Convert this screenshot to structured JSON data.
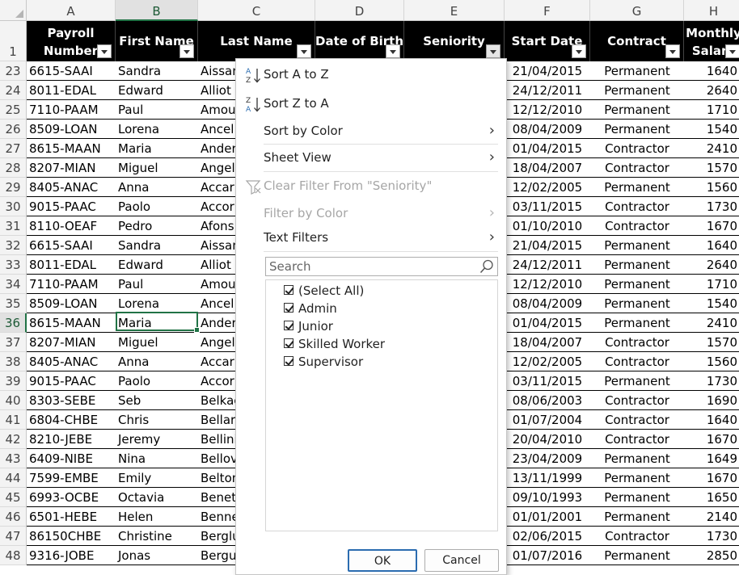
{
  "columns": [
    "A",
    "B",
    "C",
    "D",
    "E",
    "F",
    "G",
    "H"
  ],
  "header_labels": {
    "A": [
      "Payroll",
      "Number"
    ],
    "B": [
      "First Name"
    ],
    "C": [
      "Last Name"
    ],
    "D": [
      "Date of Birth"
    ],
    "E": [
      "Seniority"
    ],
    "F": [
      "Start Date"
    ],
    "G": [
      "Contract"
    ],
    "H": [
      "Monthly",
      "Salary"
    ]
  },
  "header_row_number": "1",
  "rows": [
    {
      "n": "23",
      "a": "6615-SAAI",
      "b": "Sandra",
      "c": "Aissan",
      "f": "21/04/2015",
      "g": "Permanent",
      "h": "1640"
    },
    {
      "n": "24",
      "a": "8011-EDAL",
      "b": "Edward",
      "c": "Alliot",
      "f": "24/12/2011",
      "g": "Permanent",
      "h": "2640"
    },
    {
      "n": "25",
      "a": "7110-PAAM",
      "b": "Paul",
      "c": "Amou",
      "f": "12/12/2010",
      "g": "Permanent",
      "h": "1710"
    },
    {
      "n": "26",
      "a": "8509-LOAN",
      "b": "Lorena",
      "c": "Ancel",
      "f": "08/04/2009",
      "g": "Permanent",
      "h": "1540"
    },
    {
      "n": "27",
      "a": "8615-MAAN",
      "b": "Maria",
      "c": "Ander",
      "f": "01/04/2015",
      "g": "Contractor",
      "h": "2410"
    },
    {
      "n": "28",
      "a": "8207-MIAN",
      "b": "Miguel",
      "c": "Angel",
      "f": "18/04/2007",
      "g": "Contractor",
      "h": "1570"
    },
    {
      "n": "29",
      "a": "8405-ANAC",
      "b": "Anna",
      "c": "Accar",
      "f": "12/02/2005",
      "g": "Permanent",
      "h": "1560"
    },
    {
      "n": "30",
      "a": "9015-PAAC",
      "b": "Paolo",
      "c": "Accor",
      "f": "03/11/2015",
      "g": "Contractor",
      "h": "1730"
    },
    {
      "n": "31",
      "a": "8110-OEAF",
      "b": "Pedro",
      "c": "Afons",
      "f": "01/10/2010",
      "g": "Contractor",
      "h": "1670"
    },
    {
      "n": "32",
      "a": "6615-SAAI",
      "b": "Sandra",
      "c": "Aissan",
      "f": "21/04/2015",
      "g": "Permanent",
      "h": "1640"
    },
    {
      "n": "33",
      "a": "8011-EDAL",
      "b": "Edward",
      "c": "Alliot",
      "f": "24/12/2011",
      "g": "Permanent",
      "h": "2640"
    },
    {
      "n": "34",
      "a": "7110-PAAM",
      "b": "Paul",
      "c": "Amou",
      "f": "12/12/2010",
      "g": "Permanent",
      "h": "1710"
    },
    {
      "n": "35",
      "a": "8509-LOAN",
      "b": "Lorena",
      "c": "Ancel",
      "f": "08/04/2009",
      "g": "Permanent",
      "h": "1540"
    },
    {
      "n": "36",
      "a": "8615-MAAN",
      "b": "Maria",
      "c": "Ander",
      "f": "01/04/2015",
      "g": "Permanent",
      "h": "2410"
    },
    {
      "n": "37",
      "a": "8207-MIAN",
      "b": "Miguel",
      "c": "Angel",
      "f": "18/04/2007",
      "g": "Contractor",
      "h": "1570"
    },
    {
      "n": "38",
      "a": "8405-ANAC",
      "b": "Anna",
      "c": "Accar",
      "f": "12/02/2005",
      "g": "Contractor",
      "h": "1560"
    },
    {
      "n": "39",
      "a": "9015-PAAC",
      "b": "Paolo",
      "c": "Accor",
      "f": "03/11/2015",
      "g": "Permanent",
      "h": "1730"
    },
    {
      "n": "40",
      "a": "8303-SEBE",
      "b": "Seb",
      "c": "Belkac",
      "f": "08/06/2003",
      "g": "Contractor",
      "h": "1690"
    },
    {
      "n": "41",
      "a": "6804-CHBE",
      "b": "Chris",
      "c": "Bellar",
      "f": "01/07/2004",
      "g": "Contractor",
      "h": "1640"
    },
    {
      "n": "42",
      "a": "8210-JEBE",
      "b": "Jeremy",
      "c": "Bellini",
      "f": "20/04/2010",
      "g": "Contractor",
      "h": "1670"
    },
    {
      "n": "43",
      "a": "6409-NIBE",
      "b": "Nina",
      "c": "Bellov",
      "f": "23/04/2009",
      "g": "Permanent",
      "h": "1649"
    },
    {
      "n": "44",
      "a": "7599-EMBE",
      "b": "Emily",
      "c": "Belton",
      "f": "13/11/1999",
      "g": "Permanent",
      "h": "1670"
    },
    {
      "n": "45",
      "a": "6993-OCBE",
      "b": "Octavia",
      "c": "Benet",
      "f": "09/10/1993",
      "g": "Permanent",
      "h": "1650"
    },
    {
      "n": "46",
      "a": "6501-HEBE",
      "b": "Helen",
      "c": "Benne",
      "f": "01/01/2001",
      "g": "Permanent",
      "h": "2140"
    },
    {
      "n": "47",
      "a": "86150CHBE",
      "b": "Christine",
      "c": "Berglu",
      "f": "02/06/2015",
      "g": "Contractor",
      "h": "1730"
    },
    {
      "n": "48",
      "a": "9316-JOBE",
      "b": "Jonas",
      "c": "Bergu",
      "f": "01/07/2016",
      "g": "Permanent",
      "h": "2850"
    }
  ],
  "menu": {
    "sort_az": "Sort A to Z",
    "sort_za": "Sort Z to A",
    "sort_by_color": "Sort by Color",
    "sheet_view": "Sheet View",
    "clear_filter": "Clear Filter From \"Seniority\"",
    "filter_by_color": "Filter by Color",
    "text_filters": "Text Filters",
    "search_placeholder": "Search",
    "options": [
      "(Select All)",
      "Admin",
      "Junior",
      "Skilled Worker",
      "Supervisor"
    ],
    "ok": "OK",
    "cancel": "Cancel"
  },
  "colors": {
    "accent": "#217346",
    "header_bg": "#000000",
    "header_text": "#ffffff"
  }
}
